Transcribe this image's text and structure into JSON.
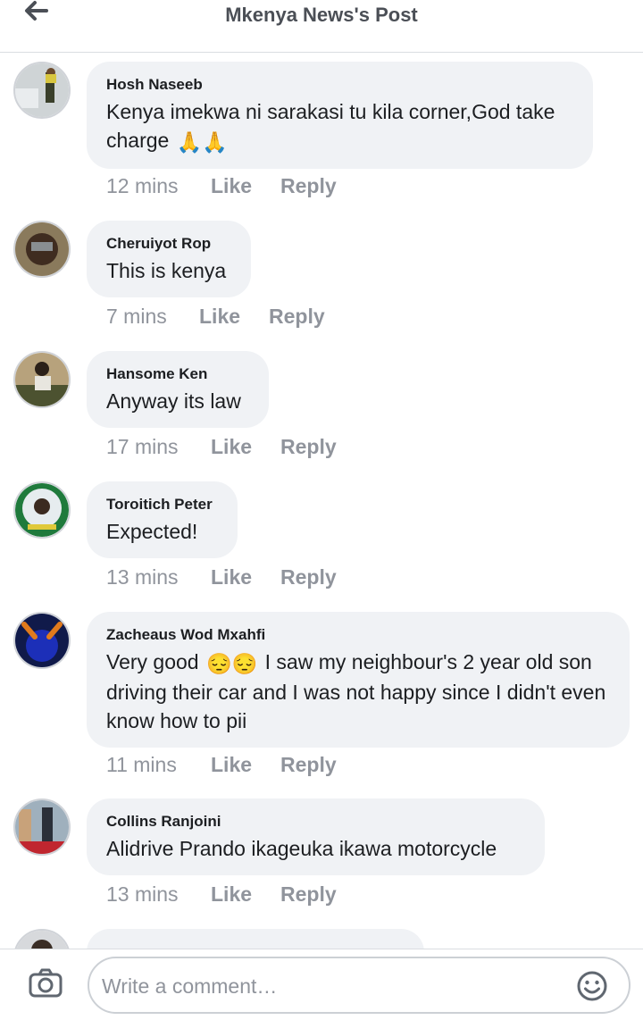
{
  "header": {
    "title": "Mkenya News's Post"
  },
  "comments": [
    {
      "author": "Hosh Naseeb",
      "text": "Kenya imekwa ni sarakasi tu kila corner,God take charge",
      "emojis": "🙏🙏",
      "time": "12 mins",
      "like": "Like",
      "reply": "Reply"
    },
    {
      "author": "Cheruiyot Rop",
      "text": "This is kenya",
      "time": "7 mins",
      "like": "Like",
      "reply": "Reply"
    },
    {
      "author": "Hansome Ken",
      "text": "Anyway its law",
      "time": "17 mins",
      "like": "Like",
      "reply": "Reply"
    },
    {
      "author": "Toroitich Peter",
      "text": "Expected!",
      "time": "13 mins",
      "like": "Like",
      "reply": "Reply"
    },
    {
      "author": "Zacheaus Wod Mxahfi",
      "text_before": "Very good",
      "emojis": "😔😔",
      "text_after": "I saw my neighbour's 2 year old son driving their car and I was not happy since I didn't even know how to pii",
      "time": "11 mins",
      "like": "Like",
      "reply": "Reply"
    },
    {
      "author": "Collins Ranjoini",
      "text": "Alidrive Prando ikageuka ikawa motorcycle",
      "time": "13 mins",
      "like": "Like",
      "reply": "Reply"
    }
  ],
  "composer": {
    "placeholder": "Write a comment…"
  },
  "icons": {
    "back": "arrow-left-icon",
    "camera": "camera-icon",
    "emoji": "smiley-icon"
  },
  "colors": {
    "bubble": "#f0f2f5",
    "meta": "#90949c",
    "text": "#1c1e21"
  }
}
